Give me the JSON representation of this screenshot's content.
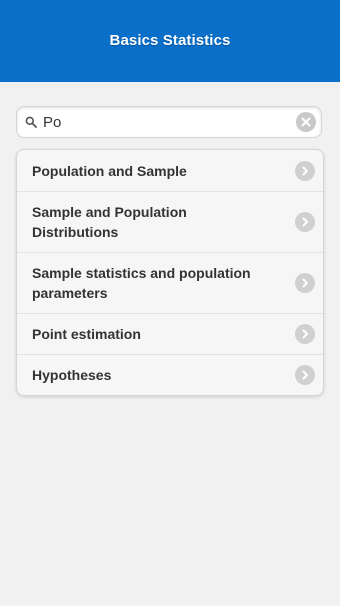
{
  "header": {
    "title": "Basics Statistics",
    "color": "#0a6fc9"
  },
  "search": {
    "value": "Po",
    "icon": "search-icon",
    "clear_icon": "clear-icon"
  },
  "list": {
    "items": [
      {
        "label": "Population and Sample",
        "icon": "chevron-right-icon"
      },
      {
        "label": "Sample and Population Distributions",
        "icon": "chevron-right-icon"
      },
      {
        "label": "Sample statistics and population parameters",
        "icon": "chevron-right-icon"
      },
      {
        "label": "Point estimation",
        "icon": "chevron-right-icon"
      },
      {
        "label": "Hypotheses",
        "icon": "chevron-right-icon"
      }
    ]
  }
}
